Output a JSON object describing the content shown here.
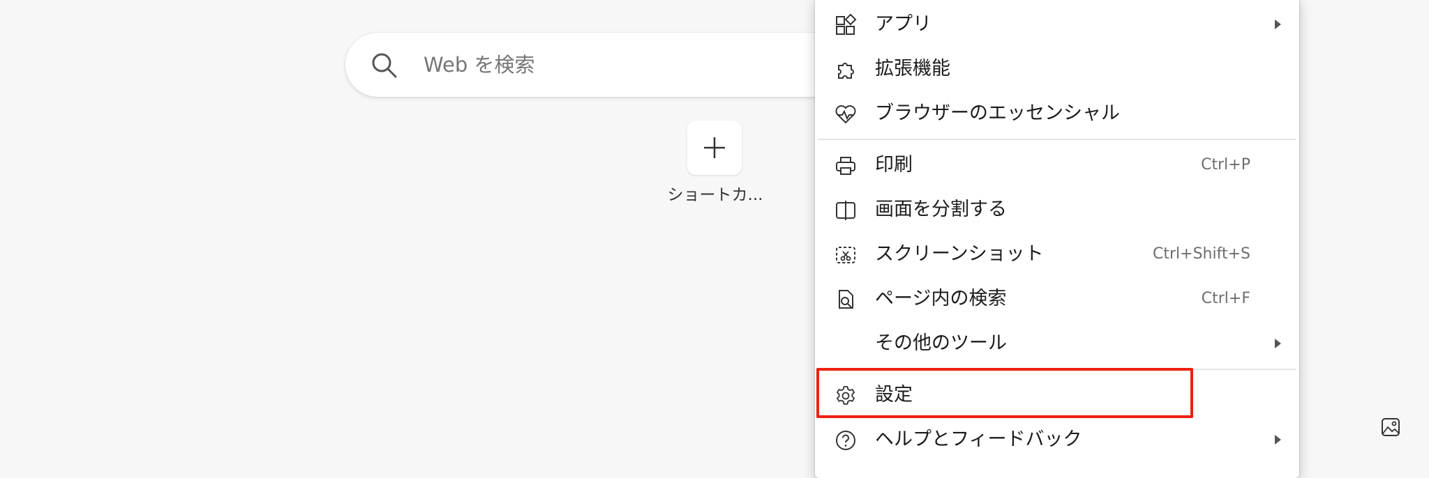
{
  "search": {
    "placeholder": "Web を検索",
    "icon": "search-icon"
  },
  "shortcuts": {
    "add_label": "ショートカ..."
  },
  "menu": {
    "items": [
      {
        "id": "apps",
        "label": "アプリ",
        "shortcut": "",
        "icon": "apps-icon",
        "submenu": true
      },
      {
        "id": "extensions",
        "label": "拡張機能",
        "shortcut": "",
        "icon": "puzzle-icon",
        "submenu": false
      },
      {
        "id": "essentials",
        "label": "ブラウザーのエッセンシャル",
        "shortcut": "",
        "icon": "heart-pulse-icon",
        "submenu": false
      },
      {
        "id": "print",
        "label": "印刷",
        "shortcut": "Ctrl+P",
        "icon": "printer-icon",
        "submenu": false
      },
      {
        "id": "split",
        "label": "画面を分割する",
        "shortcut": "",
        "icon": "split-screen-icon",
        "submenu": false
      },
      {
        "id": "screenshot",
        "label": "スクリーンショット",
        "shortcut": "Ctrl+Shift+S",
        "icon": "screenshot-icon",
        "submenu": false
      },
      {
        "id": "find",
        "label": "ページ内の検索",
        "shortcut": "Ctrl+F",
        "icon": "find-in-page-icon",
        "submenu": false
      },
      {
        "id": "more-tools",
        "label": "その他のツール",
        "shortcut": "",
        "icon": "",
        "submenu": true
      },
      {
        "id": "settings",
        "label": "設定",
        "shortcut": "",
        "icon": "gear-icon",
        "submenu": false
      },
      {
        "id": "help",
        "label": "ヘルプとフィードバック",
        "shortcut": "",
        "icon": "help-icon",
        "submenu": true
      }
    ]
  },
  "colors": {
    "highlight": "#ee2211",
    "page_bg": "#f7f7f7"
  }
}
